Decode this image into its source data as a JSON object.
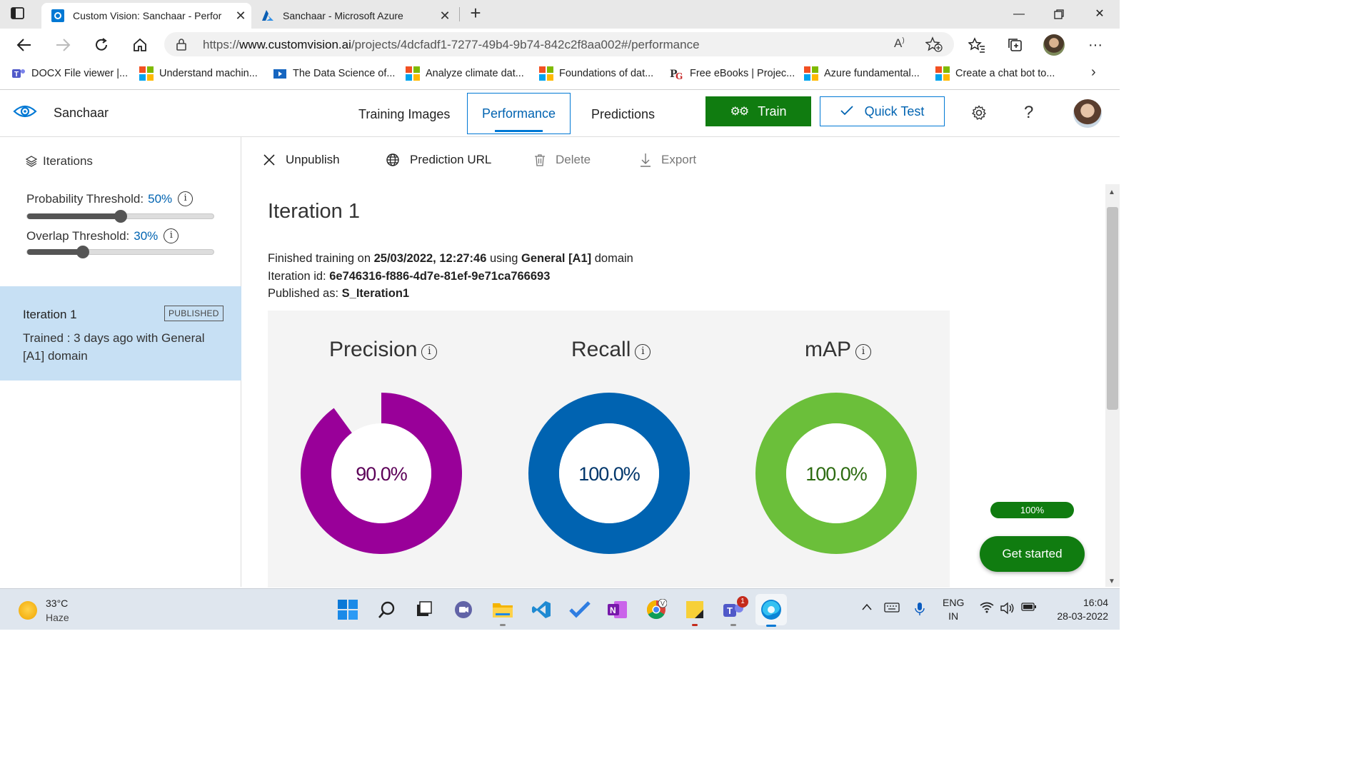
{
  "browser": {
    "tabs": [
      {
        "title": "Custom Vision: Sanchaar - Perfor",
        "active": true
      },
      {
        "title": "Sanchaar - Microsoft Azure",
        "active": false
      }
    ],
    "url_prefix": "https://",
    "url_domain": "www.customvision.ai",
    "url_path": "/projects/4dcfadf1-7277-49b4-9b74-842c2f8aa002#/performance",
    "bookmarks": [
      "DOCX File viewer |...",
      "Understand machin...",
      "The Data Science of...",
      "Analyze climate dat...",
      "Foundations of dat...",
      "Free eBooks | Projec...",
      "Azure fundamental...",
      "Create a chat bot to..."
    ]
  },
  "app": {
    "project_name": "Sanchaar",
    "nav": {
      "training_images": "Training Images",
      "performance": "Performance",
      "predictions": "Predictions"
    },
    "train_label": "Train",
    "quick_test_label": "Quick Test",
    "help_label": "?"
  },
  "sidebar": {
    "iterations_label": "Iterations",
    "probability_label": "Probability Threshold:",
    "probability_value": "50%",
    "probability_fraction": 0.5,
    "overlap_label": "Overlap Threshold:",
    "overlap_value": "30%",
    "overlap_fraction": 0.3,
    "iteration": {
      "name": "Iteration 1",
      "badge": "PUBLISHED",
      "description": "Trained : 3 days ago with General [A1] domain"
    }
  },
  "toolbar": {
    "unpublish": "Unpublish",
    "prediction_url": "Prediction URL",
    "delete": "Delete",
    "export": "Export"
  },
  "main": {
    "title": "Iteration 1",
    "finished_prefix": "Finished training on ",
    "finished_date": "25/03/2022, 12:27:46",
    "finished_mid": " using ",
    "finished_domain": "General [A1]",
    "finished_suffix": " domain",
    "iteration_id_label": "Iteration id: ",
    "iteration_id": "6e746316-f886-4d7e-81ef-9e71ca766693",
    "published_label": "Published as: ",
    "published_name": "S_Iteration1",
    "metrics": [
      {
        "name": "Precision",
        "value_text": "90.0%",
        "value": 0.9,
        "color": "#990099",
        "text_color": "#5c0058"
      },
      {
        "name": "Recall",
        "value_text": "100.0%",
        "value": 1.0,
        "color": "#0063b1",
        "text_color": "#00366b"
      },
      {
        "name": "mAP",
        "value_text": "100.0%",
        "value": 1.0,
        "color": "#6bbf3a",
        "text_color": "#2c6b10"
      }
    ]
  },
  "progress_label": "100%",
  "progress_value": 1.0,
  "get_started_label": "Get started",
  "taskbar": {
    "temperature": "33°C",
    "weather": "Haze",
    "lang_top": "ENG",
    "lang_bottom": "IN",
    "time": "16:04",
    "date": "28-03-2022",
    "teams_badge": "1"
  }
}
